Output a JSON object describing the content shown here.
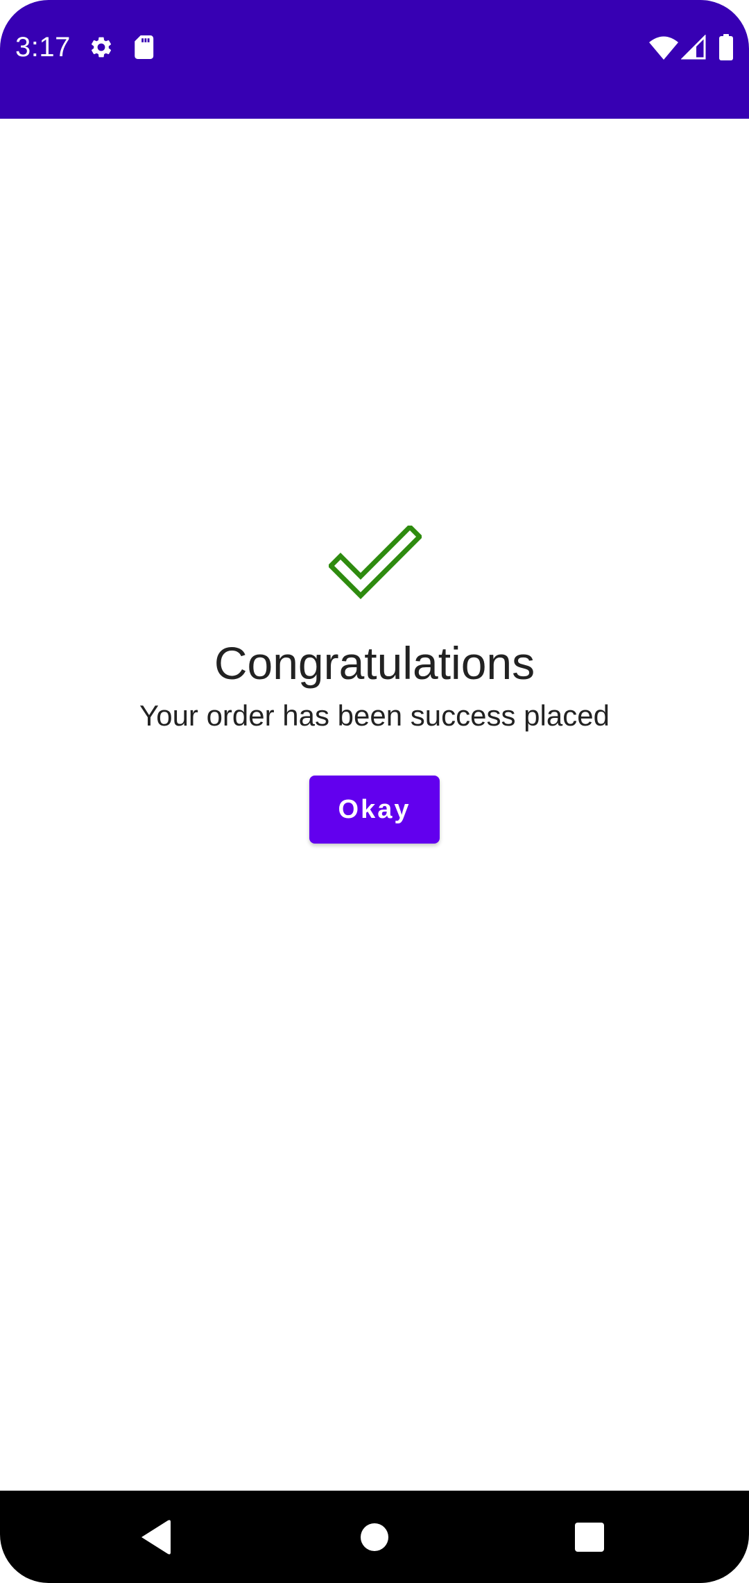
{
  "status_bar": {
    "time": "3:17",
    "background_color": "#3700b3",
    "icons": [
      "settings-icon",
      "sd-card-icon",
      "wifi-icon",
      "cell-signal-icon",
      "battery-icon"
    ]
  },
  "main": {
    "icon": "check-icon",
    "icon_color": "#2e8b0f",
    "title": "Congratulations",
    "message": "Your order has been success placed",
    "okay_label": "Okay",
    "button_color": "#6200ee"
  },
  "nav_bar": {
    "buttons": [
      "back-icon",
      "home-icon",
      "recents-icon"
    ]
  }
}
